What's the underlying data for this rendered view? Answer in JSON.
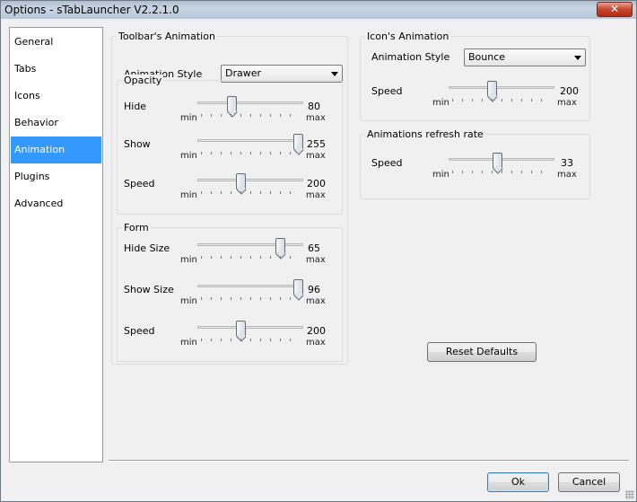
{
  "window": {
    "title": "Options - sTabLauncher V2.2.1.0",
    "close_glyph": "✕"
  },
  "nav": {
    "items": [
      {
        "label": "General"
      },
      {
        "label": "Tabs"
      },
      {
        "label": "Icons"
      },
      {
        "label": "Behavior"
      },
      {
        "label": "Animation",
        "active": true
      },
      {
        "label": "Plugins"
      },
      {
        "label": "Advanced"
      }
    ]
  },
  "toolbar_anim": {
    "title": "Toolbar's Animation",
    "style_label": "Animation Style",
    "style_value": "Drawer",
    "opacity": {
      "title": "Opacity",
      "hide": {
        "label": "Hide",
        "value": "80",
        "min": "min",
        "max": "max",
        "fraction": 0.31
      },
      "show": {
        "label": "Show",
        "value": "255",
        "min": "min",
        "max": "max",
        "fraction": 1.0
      },
      "speed": {
        "label": "Speed",
        "value": "200",
        "min": "min",
        "max": "max",
        "fraction": 0.4
      }
    },
    "form": {
      "title": "Form",
      "hide_size": {
        "label": "Hide Size",
        "value": "65",
        "min": "min",
        "max": "max",
        "fraction": 0.81
      },
      "show_size": {
        "label": "Show Size",
        "value": "96",
        "min": "min",
        "max": "max",
        "fraction": 1.0
      },
      "speed": {
        "label": "Speed",
        "value": "200",
        "min": "min",
        "max": "max",
        "fraction": 0.4
      }
    }
  },
  "icon_anim": {
    "title": "Icon's Animation",
    "style_label": "Animation Style",
    "style_value": "Bounce",
    "speed": {
      "label": "Speed",
      "value": "200",
      "min": "min",
      "max": "max",
      "fraction": 0.4
    }
  },
  "refresh": {
    "title": "Animations refresh rate",
    "speed": {
      "label": "Speed",
      "value": "33",
      "min": "min",
      "max": "max",
      "fraction": 0.46
    }
  },
  "buttons": {
    "reset": "Reset Defaults",
    "ok": "Ok",
    "cancel": "Cancel"
  },
  "colors": {
    "accent": "#3399ff",
    "window_bg": "#f0f0f0"
  }
}
